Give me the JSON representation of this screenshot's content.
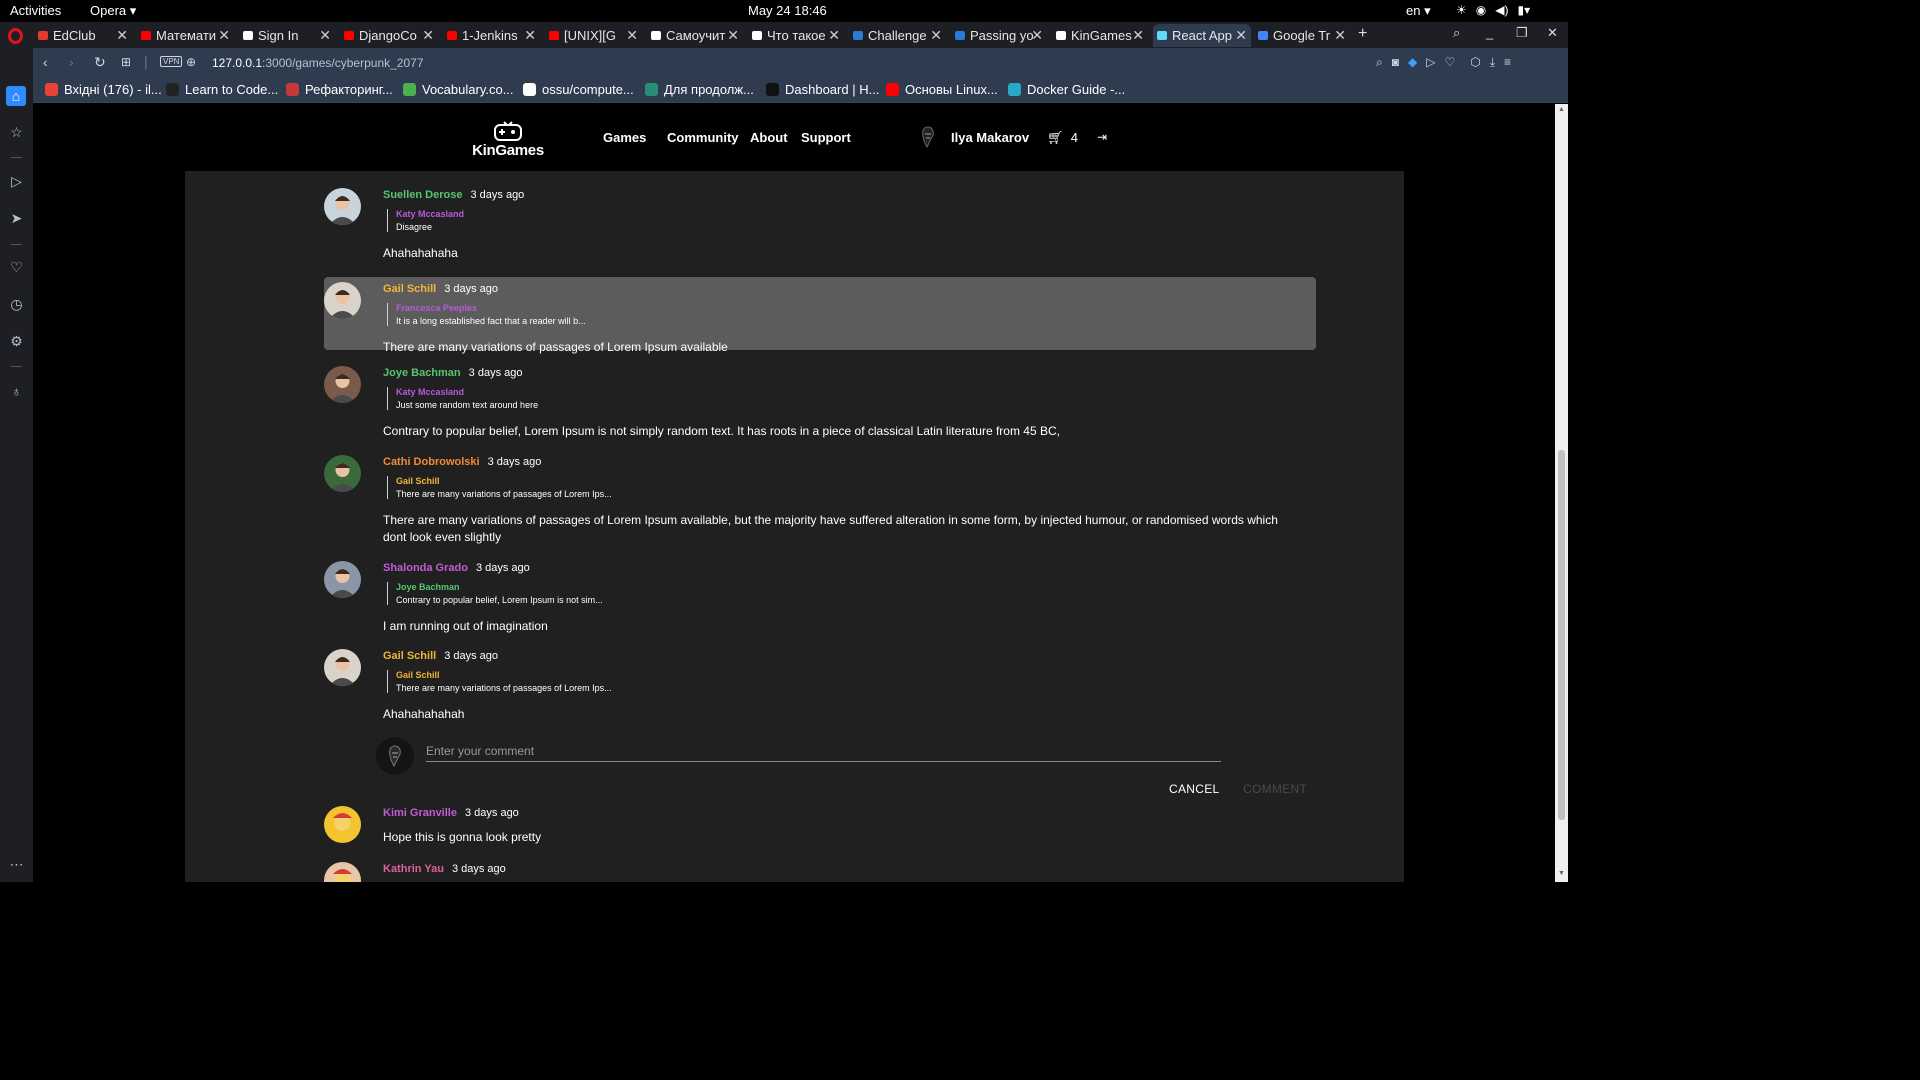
{
  "system_bar": {
    "activities": "Activities",
    "app": "Opera",
    "clock": "May 24  18:46",
    "lang": "en"
  },
  "tabs": [
    {
      "label": "EdClub",
      "color": "#e23b2e"
    },
    {
      "label": "Математи",
      "color": "#ff0000"
    },
    {
      "label": "Sign In",
      "color": "#ffffff"
    },
    {
      "label": "DjangoCo",
      "color": "#ff0000"
    },
    {
      "label": "1-Jenkins",
      "color": "#ff0000"
    },
    {
      "label": "[UNIX][G",
      "color": "#ff0000"
    },
    {
      "label": "Самоучит",
      "color": "#ffffff"
    },
    {
      "label": "Что такое",
      "color": "#ffffff"
    },
    {
      "label": "Challenge",
      "color": "#2b7bd6"
    },
    {
      "label": "Passing yo",
      "color": "#2b7bd6"
    },
    {
      "label": "KinGames",
      "color": "#ffffff"
    },
    {
      "label": "React App",
      "color": "#61dafb"
    },
    {
      "label": "Google Tr",
      "color": "#4285f4"
    }
  ],
  "address": {
    "host": "127.0.0.1",
    "path": ":3000/games/cyberpunk_2077",
    "vpn": "VPN"
  },
  "bookmarks": [
    {
      "label": "Вхідні (176) - il...",
      "color": "#ea4335"
    },
    {
      "label": "Learn to Code...",
      "color": "#222222"
    },
    {
      "label": "Рефакторинг...",
      "color": "#c43a3a"
    },
    {
      "label": "Vocabulary.co...",
      "color": "#4caf50"
    },
    {
      "label": "ossu/compute...",
      "color": "#ffffff"
    },
    {
      "label": "Для продолж...",
      "color": "#2a8d7a"
    },
    {
      "label": "Dashboard | H...",
      "color": "#111111"
    },
    {
      "label": "Основы Linux...",
      "color": "#ff0000"
    },
    {
      "label": "Docker Guide -...",
      "color": "#2aa7c9"
    }
  ],
  "site": {
    "brand": "KinGames",
    "nav": [
      "Games",
      "Community",
      "About",
      "Support"
    ],
    "user_name": "Ilya Makarov",
    "cart_count": "4"
  },
  "comments": [
    {
      "author": "Suellen Derose",
      "author_color": "#58c46e",
      "time": "3 days ago",
      "reply_author": "Katy Mccasland",
      "reply_color": "#b45cd6",
      "reply_text": "Disagree",
      "text": "Ahahahahaha",
      "avatar_bg": "#c8d4dc",
      "highlight": false
    },
    {
      "author": "Gail Schill",
      "author_color": "#f0b43a",
      "time": "3 days ago",
      "reply_author": "Francesca Peeples",
      "reply_color": "#b45cd6",
      "reply_text": "It is a long established fact that a reader will b...",
      "text": "There are many variations of passages of Lorem Ipsum available",
      "avatar_bg": "#d9d3cc",
      "highlight": true
    },
    {
      "author": "Joye Bachman",
      "author_color": "#58c46e",
      "time": "3 days ago",
      "reply_author": "Katy Mccasland",
      "reply_color": "#b45cd6",
      "reply_text": "Just some random text around here",
      "text": "Contrary to popular belief, Lorem Ipsum is not simply random text. It has roots in a piece of classical Latin literature from 45 BC,",
      "avatar_bg": "#7a5a4a",
      "highlight": false
    },
    {
      "author": "Cathi Dobrowolski",
      "author_color": "#f08a3a",
      "time": "3 days ago",
      "reply_author": "Gail Schill",
      "reply_color": "#f0b43a",
      "reply_text": "There are many variations of passages of Lorem Ips...",
      "text": "There are many variations of passages of Lorem Ipsum available, but the majority have suffered alteration in some form, by injected humour, or randomised words which dont look even slightly",
      "avatar_bg": "#3a6a3a",
      "highlight": false
    },
    {
      "author": "Shalonda Grado",
      "author_color": "#c45ad6",
      "time": "3 days ago",
      "reply_author": "Joye Bachman",
      "reply_color": "#58c46e",
      "reply_text": "Contrary to popular belief, Lorem Ipsum is not sim...",
      "text": "I am running out of imagination",
      "avatar_bg": "#8a96a8",
      "highlight": false
    },
    {
      "author": "Gail Schill",
      "author_color": "#f0b43a",
      "time": "3 days ago",
      "reply_author": "Gail Schill",
      "reply_color": "#f0b43a",
      "reply_text": "There are many variations of passages of Lorem Ips...",
      "text": "Ahahahahahah",
      "avatar_bg": "#d9d3cc",
      "highlight": false
    }
  ],
  "comment_form": {
    "placeholder": "Enter your comment",
    "cancel": "CANCEL",
    "submit": "COMMENT"
  },
  "comments_after": [
    {
      "author": "Kimi Granville",
      "author_color": "#c45ad6",
      "time": "3 days ago",
      "text": "Hope this is gonna look pretty",
      "avatar_bg": "#f4c430"
    },
    {
      "author": "Kathrin Yau",
      "author_color": "#e0609a",
      "time": "3 days ago",
      "text": "",
      "avatar_bg": "#e8c7a8"
    }
  ]
}
